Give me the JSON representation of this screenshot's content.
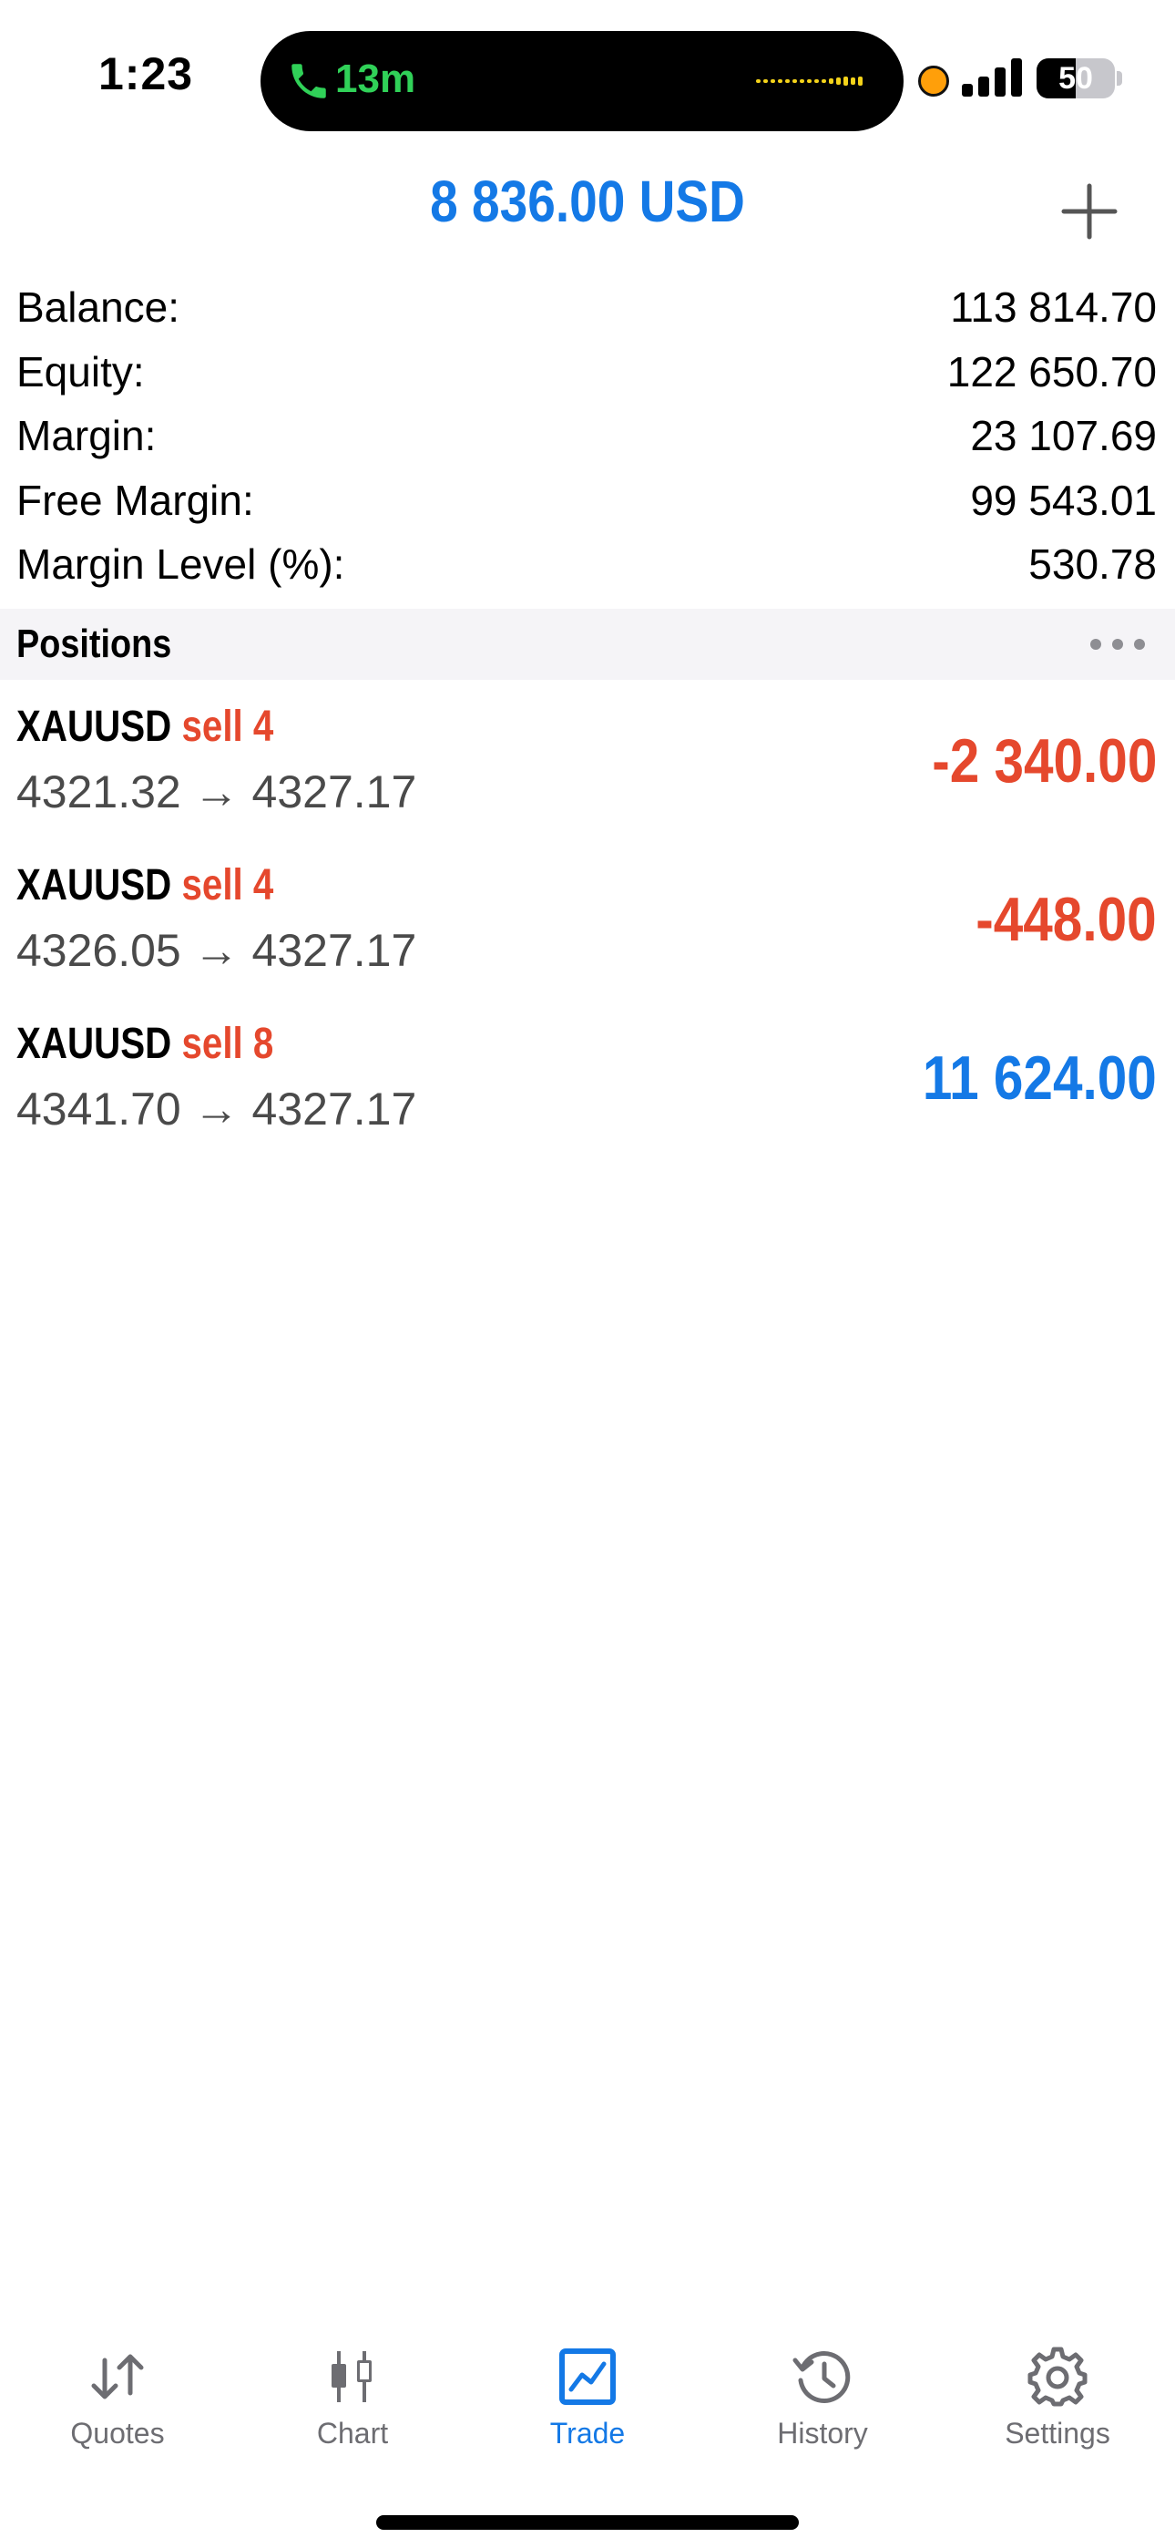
{
  "status_bar": {
    "time": "1:23",
    "call_duration": "13m",
    "battery_level": "50",
    "battery_fraction": 0.5,
    "colors": {
      "call": "#30d158",
      "privacy_dot": "#ff9f0a"
    }
  },
  "header": {
    "total_profit": "8 836.00 USD",
    "add_icon": "plus-icon",
    "colors": {
      "profit": "#1479e6"
    }
  },
  "summary": {
    "rows": [
      {
        "label": "Balance:",
        "value": "113 814.70"
      },
      {
        "label": "Equity:",
        "value": "122 650.70"
      },
      {
        "label": "Margin:",
        "value": "23 107.69"
      },
      {
        "label": "Free Margin:",
        "value": "99 543.01"
      },
      {
        "label": "Margin Level (%):",
        "value": "530.78"
      }
    ]
  },
  "positions": {
    "title": "Positions",
    "more_icon": "ellipsis-icon",
    "items": [
      {
        "symbol": "XAUUSD",
        "side": "sell 4",
        "prices": "4321.32 → 4327.17",
        "profit": "-2 340.00"
      },
      {
        "symbol": "XAUUSD",
        "side": "sell 4",
        "prices": "4326.05 → 4327.17",
        "profit": "-448.00"
      },
      {
        "symbol": "XAUUSD",
        "side": "sell 8",
        "prices": "4341.70 → 4327.17",
        "profit": "11 624.00"
      }
    ],
    "colors": {
      "loss": "#e5482d",
      "gain": "#1479e6",
      "sell": "#e5482d"
    }
  },
  "tab_bar": {
    "tabs": [
      {
        "label": "Quotes",
        "icon": "quotes-arrows-icon",
        "active": false
      },
      {
        "label": "Chart",
        "icon": "candlestick-icon",
        "active": false
      },
      {
        "label": "Trade",
        "icon": "trade-chart-icon",
        "active": true
      },
      {
        "label": "History",
        "icon": "history-clock-icon",
        "active": false
      },
      {
        "label": "Settings",
        "icon": "gear-icon",
        "active": false
      }
    ],
    "colors": {
      "active": "#1479e6",
      "inactive": "#6d6d72"
    }
  }
}
